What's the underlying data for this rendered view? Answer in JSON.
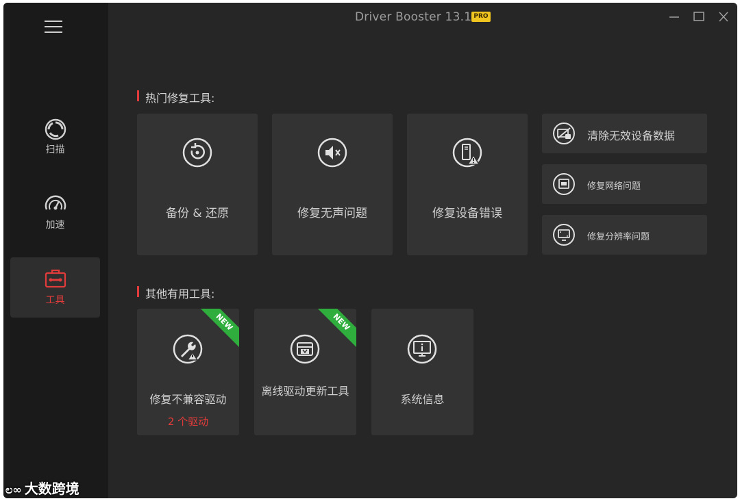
{
  "app": {
    "title": "Driver Booster 13.1",
    "badge": "PRO"
  },
  "sidebar": {
    "items": [
      {
        "label": "扫描",
        "icon": "scan-icon"
      },
      {
        "label": "加速",
        "icon": "speedometer-icon"
      },
      {
        "label": "工具",
        "icon": "toolbox-icon",
        "active": true
      }
    ]
  },
  "sections": {
    "hot_title": "热门修复工具:",
    "other_title": "其他有用工具:"
  },
  "hot_tools": {
    "backup": "备份 & 还原",
    "no_sound": "修复无声问题",
    "device_error": "修复设备错误",
    "clear_invalid": "清除无效设备数据",
    "network": "修复网络问题",
    "resolution": "修复分辨率问题"
  },
  "other_tools": {
    "incompatible": {
      "label": "修复不兼容驱动",
      "sub": "2 个驱动",
      "ribbon": "NEW"
    },
    "offline": {
      "label": "离线驱动更新工具",
      "ribbon": "NEW"
    },
    "sysinfo": {
      "label": "系统信息"
    }
  },
  "watermark": {
    "text": "大数跨境"
  },
  "colors": {
    "accent": "#e23b3b",
    "new_ribbon": "#2fae3d",
    "pro_badge": "#f0c520"
  }
}
